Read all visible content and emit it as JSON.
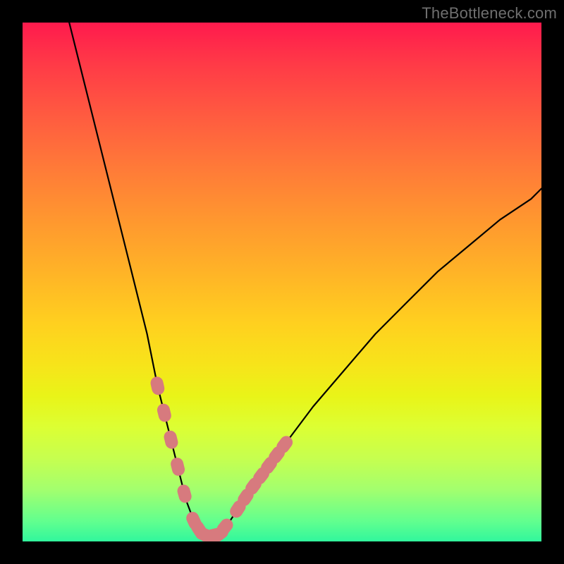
{
  "watermark": "TheBottleneck.com",
  "colors": {
    "frame": "#000000",
    "curve": "#000000",
    "badge": "#d77a7e",
    "gradient_top": "#ff1a4d",
    "gradient_bottom": "#31f79d"
  },
  "chart_data": {
    "type": "line",
    "title": "",
    "xlabel": "",
    "ylabel": "",
    "xlim": [
      0,
      100
    ],
    "ylim": [
      0,
      100
    ],
    "grid": false,
    "legend": false,
    "annotations": [
      "TheBottleneck.com"
    ],
    "series": [
      {
        "name": "bottleneck-curve",
        "x": [
          9,
          12,
          15,
          18,
          21,
          24,
          26,
          28,
          30,
          31.5,
          33,
          34.5,
          36,
          38,
          40,
          44,
          50,
          56,
          62,
          68,
          74,
          80,
          86,
          92,
          98,
          100
        ],
        "y": [
          100,
          88,
          76,
          64,
          52,
          40,
          30,
          22,
          14,
          8,
          4,
          1.5,
          1,
          1.5,
          4,
          10,
          18,
          26,
          33,
          40,
          46,
          52,
          57,
          62,
          66,
          68
        ]
      }
    ],
    "markers": [
      {
        "name": "left-cluster",
        "x": [
          26.0,
          27.3,
          28.6,
          29.9,
          31.2
        ],
        "y_from_curve": true
      },
      {
        "name": "valley",
        "x": [
          33.0,
          34.0,
          35.0,
          36.0,
          37.0,
          38.0,
          39.0
        ],
        "y_from_curve": true
      },
      {
        "name": "right-cluster",
        "x": [
          41.5,
          43.0,
          44.5,
          46.0,
          47.5,
          49.0,
          50.5
        ],
        "y_from_curve": true
      }
    ]
  }
}
